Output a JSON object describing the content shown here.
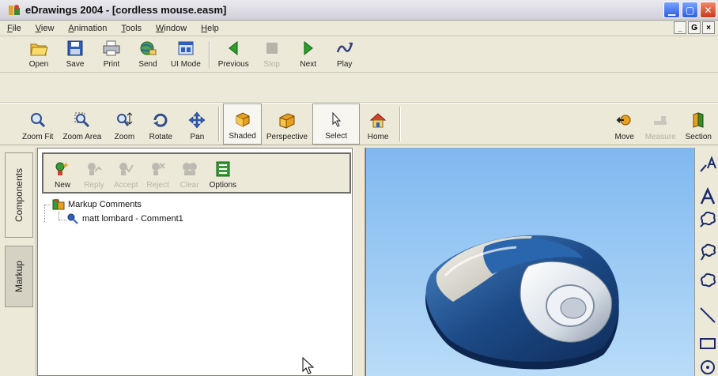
{
  "window": {
    "title": "eDrawings 2004 - [cordless mouse.easm]",
    "controls": [
      "minimize",
      "maximize",
      "close"
    ]
  },
  "menu": {
    "items": [
      "File",
      "View",
      "Animation",
      "Tools",
      "Window",
      "Help"
    ],
    "mdi_controls": [
      "_",
      "Ǥ",
      "×"
    ]
  },
  "toolbar_top": {
    "groups": [
      [
        {
          "label": "Open",
          "icon": "open-folder-icon",
          "enabled": true
        },
        {
          "label": "Save",
          "icon": "save-disk-icon",
          "enabled": true
        },
        {
          "label": "Print",
          "icon": "printer-icon",
          "enabled": true
        },
        {
          "label": "Send",
          "icon": "send-globe-icon",
          "enabled": true
        },
        {
          "label": "UI Mode",
          "icon": "ui-mode-icon",
          "enabled": true
        }
      ],
      [
        {
          "label": "Previous",
          "icon": "previous-arrow-icon",
          "enabled": true
        },
        {
          "label": "Stop",
          "icon": "stop-icon",
          "enabled": false
        },
        {
          "label": "Next",
          "icon": "next-arrow-icon",
          "enabled": true
        },
        {
          "label": "Play",
          "icon": "play-icon",
          "enabled": true
        }
      ]
    ]
  },
  "toolbar_view": {
    "groups": [
      [
        {
          "label": "Zoom Fit",
          "icon": "zoom-fit-icon",
          "enabled": true
        },
        {
          "label": "Zoom Area",
          "icon": "zoom-area-icon",
          "enabled": true
        },
        {
          "label": "Zoom",
          "icon": "zoom-icon",
          "enabled": true
        },
        {
          "label": "Rotate",
          "icon": "rotate-icon",
          "enabled": true
        },
        {
          "label": "Pan",
          "icon": "pan-icon",
          "enabled": true
        }
      ],
      [
        {
          "label": "Shaded",
          "icon": "shaded-box-icon",
          "enabled": true,
          "pressed": true
        },
        {
          "label": "Perspective",
          "icon": "perspective-box-icon",
          "enabled": true
        },
        {
          "label": "Select",
          "icon": "select-arrow-icon",
          "enabled": true,
          "pressed": true
        },
        {
          "label": "Home",
          "icon": "home-icon",
          "enabled": true
        }
      ],
      [
        {
          "label": "Move",
          "icon": "move-icon",
          "enabled": true
        },
        {
          "label": "Measure",
          "icon": "measure-icon",
          "enabled": false
        },
        {
          "label": "Section",
          "icon": "section-icon",
          "enabled": true
        }
      ]
    ]
  },
  "side_tabs": [
    "Components",
    "Markup"
  ],
  "markup_toolbar": [
    {
      "label": "New",
      "icon": "new-comment-icon",
      "enabled": true
    },
    {
      "label": "Reply",
      "icon": "reply-icon",
      "enabled": false
    },
    {
      "label": "Accept",
      "icon": "accept-icon",
      "enabled": false
    },
    {
      "label": "Reject",
      "icon": "reject-icon",
      "enabled": false
    },
    {
      "label": "Clear",
      "icon": "clear-icon",
      "enabled": false
    },
    {
      "label": "Options",
      "icon": "options-icon",
      "enabled": true
    }
  ],
  "tree": {
    "root": "Markup Comments",
    "children": [
      "matt lombard - Comment1"
    ]
  },
  "right_tools": [
    "text-arrow-icon",
    "text-icon",
    "cloud-text-icon",
    "cloud-leader-icon",
    "cloud-icon",
    "line-icon",
    "rectangle-icon",
    "circle-icon"
  ],
  "colors": {
    "viewport_top": "#7fb8f0",
    "viewport_bottom": "#b9dcf8",
    "mouse_blue": "#1c4a86",
    "mouse_silver": "#d8dfe6"
  }
}
